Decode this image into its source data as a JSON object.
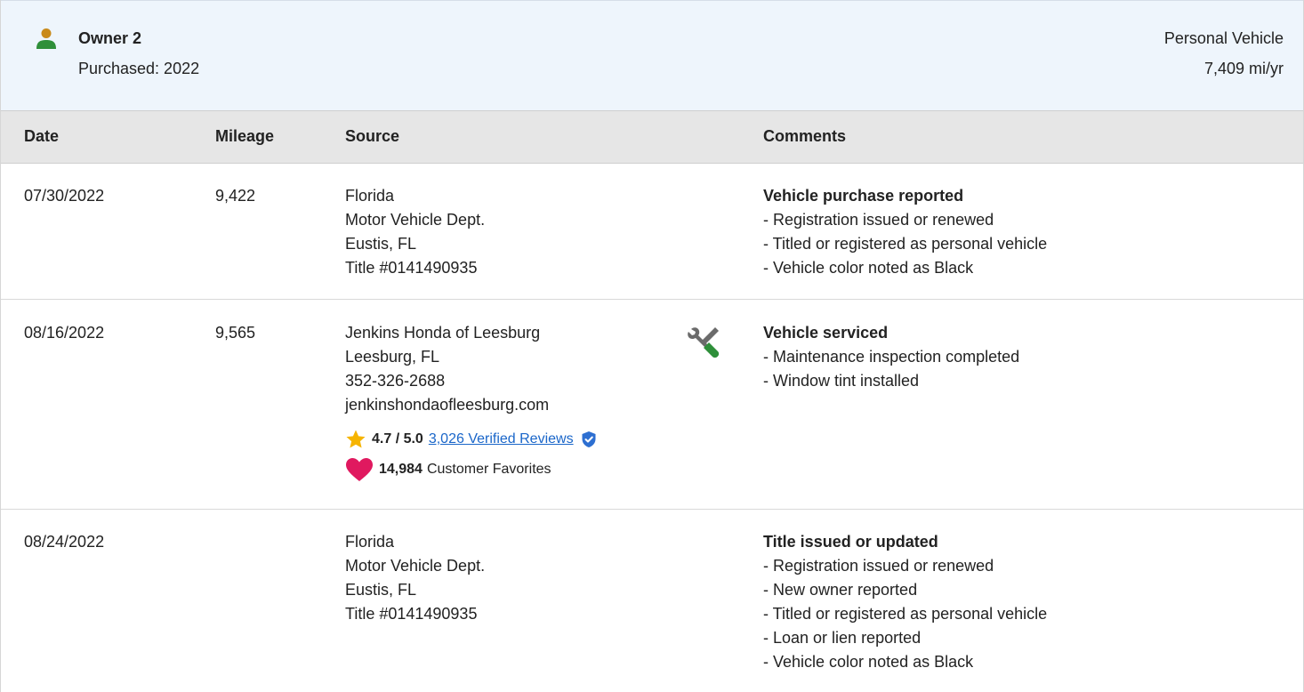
{
  "owner": {
    "title": "Owner 2",
    "purchased": "Purchased: 2022",
    "vehicle_type": "Personal Vehicle",
    "miles_per_year": "7,409 mi/yr",
    "icon": "person-icon",
    "icon_color": "#3a8f3a"
  },
  "table": {
    "headers": [
      "Date",
      "Mileage",
      "Source",
      "Comments"
    ],
    "rows": [
      {
        "date": "07/30/2022",
        "mileage": "9,422",
        "source": [
          "Florida",
          "Motor Vehicle Dept.",
          "Eustis, FL",
          "Title #0141490935"
        ],
        "comment_title": "Vehicle purchase reported",
        "comments": [
          "- Registration issued or renewed",
          "- Titled or registered as personal vehicle",
          "- Vehicle color noted as Black"
        ]
      },
      {
        "date": "08/16/2022",
        "mileage": "9,565",
        "source": [
          "Jenkins Honda of Leesburg",
          "Leesburg, FL",
          "352-326-2688",
          "jenkinshondaofleesburg.com"
        ],
        "icon": "service-tools-icon",
        "rating": "4.7 / 5.0",
        "reviews_link": "3,026 Verified Reviews",
        "favorites_count": "14,984",
        "favorites_label": "Customer Favorites",
        "comment_title": "Vehicle serviced",
        "comments": [
          "- Maintenance inspection completed",
          "- Window tint installed"
        ]
      },
      {
        "date": "08/24/2022",
        "mileage": "",
        "source": [
          "Florida",
          "Motor Vehicle Dept.",
          "Eustis, FL",
          "Title #0141490935"
        ],
        "comment_title": "Title issued or updated",
        "comments": [
          "- Registration issued or renewed",
          "- New owner reported",
          "- Titled or registered as personal vehicle",
          "- Loan or lien reported",
          "- Vehicle color noted as Black"
        ]
      }
    ]
  },
  "colors": {
    "header_bg": "#eef5fc",
    "table_head_bg": "#e6e6e6",
    "link": "#1a66c9",
    "star": "#f6b400",
    "heart": "#e0195f",
    "verified": "#2d6fd1"
  }
}
